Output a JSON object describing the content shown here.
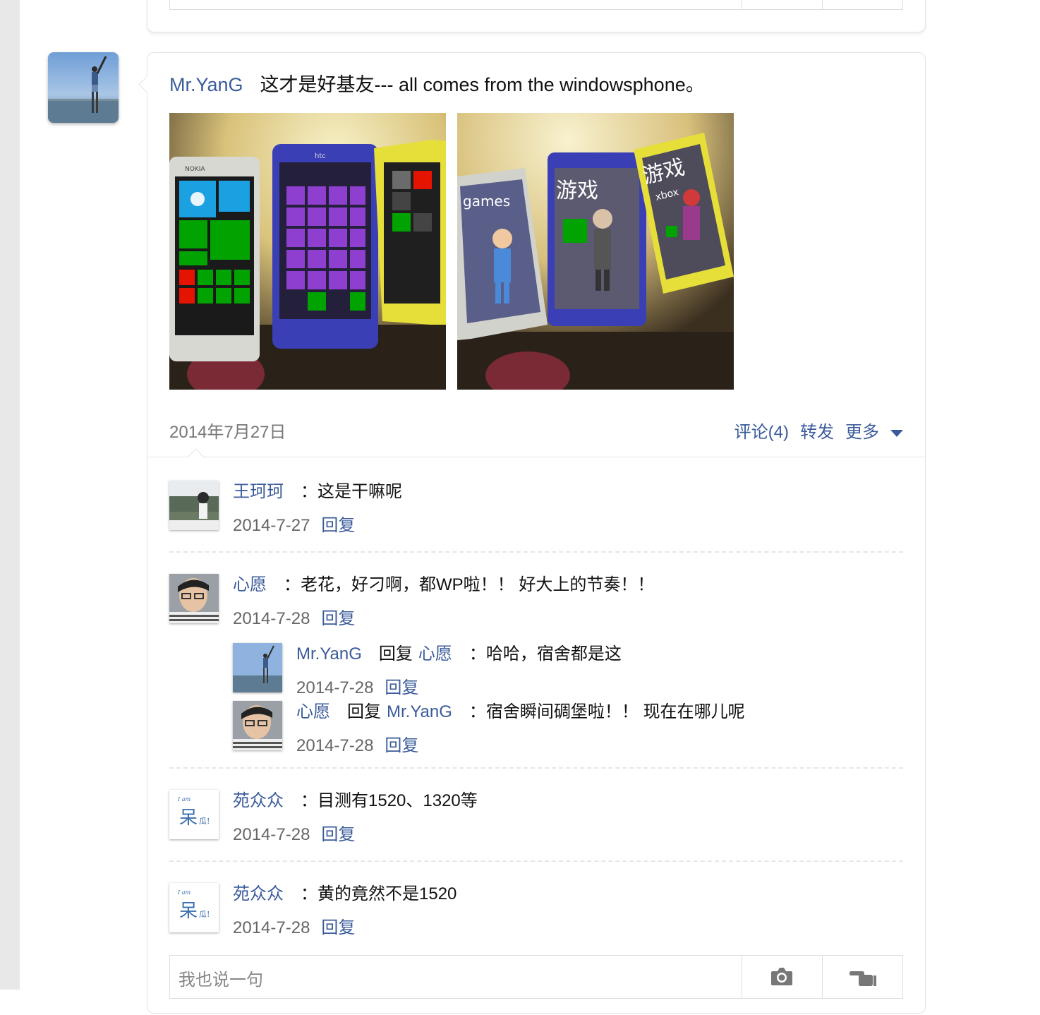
{
  "post": {
    "author": "Mr.YanG",
    "text": "这才是好基友--- all comes from the windowsphone。",
    "date": "2014年7月27日",
    "actions": {
      "comment": "评论(4)",
      "share": "转发",
      "more": "更多"
    },
    "photos": [
      {
        "screen_text": "NOKIA",
        "screen_text2": "htc"
      },
      {
        "screen_text": "games",
        "screen_text2": "游戏",
        "screen_text3": "游戏",
        "screen_text4": "xbox"
      }
    ]
  },
  "comments": [
    {
      "author": "王珂珂",
      "text": "：这是干嘛呢",
      "date": "2014-7-27",
      "reply": "回复"
    },
    {
      "author": "心愿",
      "text": "：老花，好刁啊，都WP啦！！ 好大上的节奏！！",
      "date": "2014-7-28",
      "reply": "回复",
      "replies": [
        {
          "author": "Mr.YanG",
          "reply_word": "回复",
          "target": "心愿",
          "text": "：哈哈，宿舍都是这",
          "date": "2014-7-28",
          "reply": "回复"
        },
        {
          "author": "心愿",
          "reply_word": "回复",
          "target": "Mr.YanG",
          "text": "：宿舍瞬间碉堡啦！！ 现在在哪儿呢",
          "date": "2014-7-28",
          "reply": "回复"
        }
      ]
    },
    {
      "author": "苑众众",
      "text": "：目测有1520、1320等",
      "date": "2014-7-28",
      "reply": "回复",
      "avatar_text": "I am",
      "avatar_text2": "呆",
      "avatar_text3": "瓜!"
    },
    {
      "author": "苑众众",
      "text": "：黄的竟然不是1520",
      "date": "2014-7-28",
      "reply": "回复",
      "avatar_text": "I am",
      "avatar_text2": "呆",
      "avatar_text3": "瓜!"
    }
  ],
  "input": {
    "placeholder": "我也说一句",
    "camera_icon": "camera-icon",
    "hand_icon": "pointing-hand-icon"
  },
  "colors": {
    "link": "#3a5b9a",
    "border": "#e3e3e3"
  }
}
